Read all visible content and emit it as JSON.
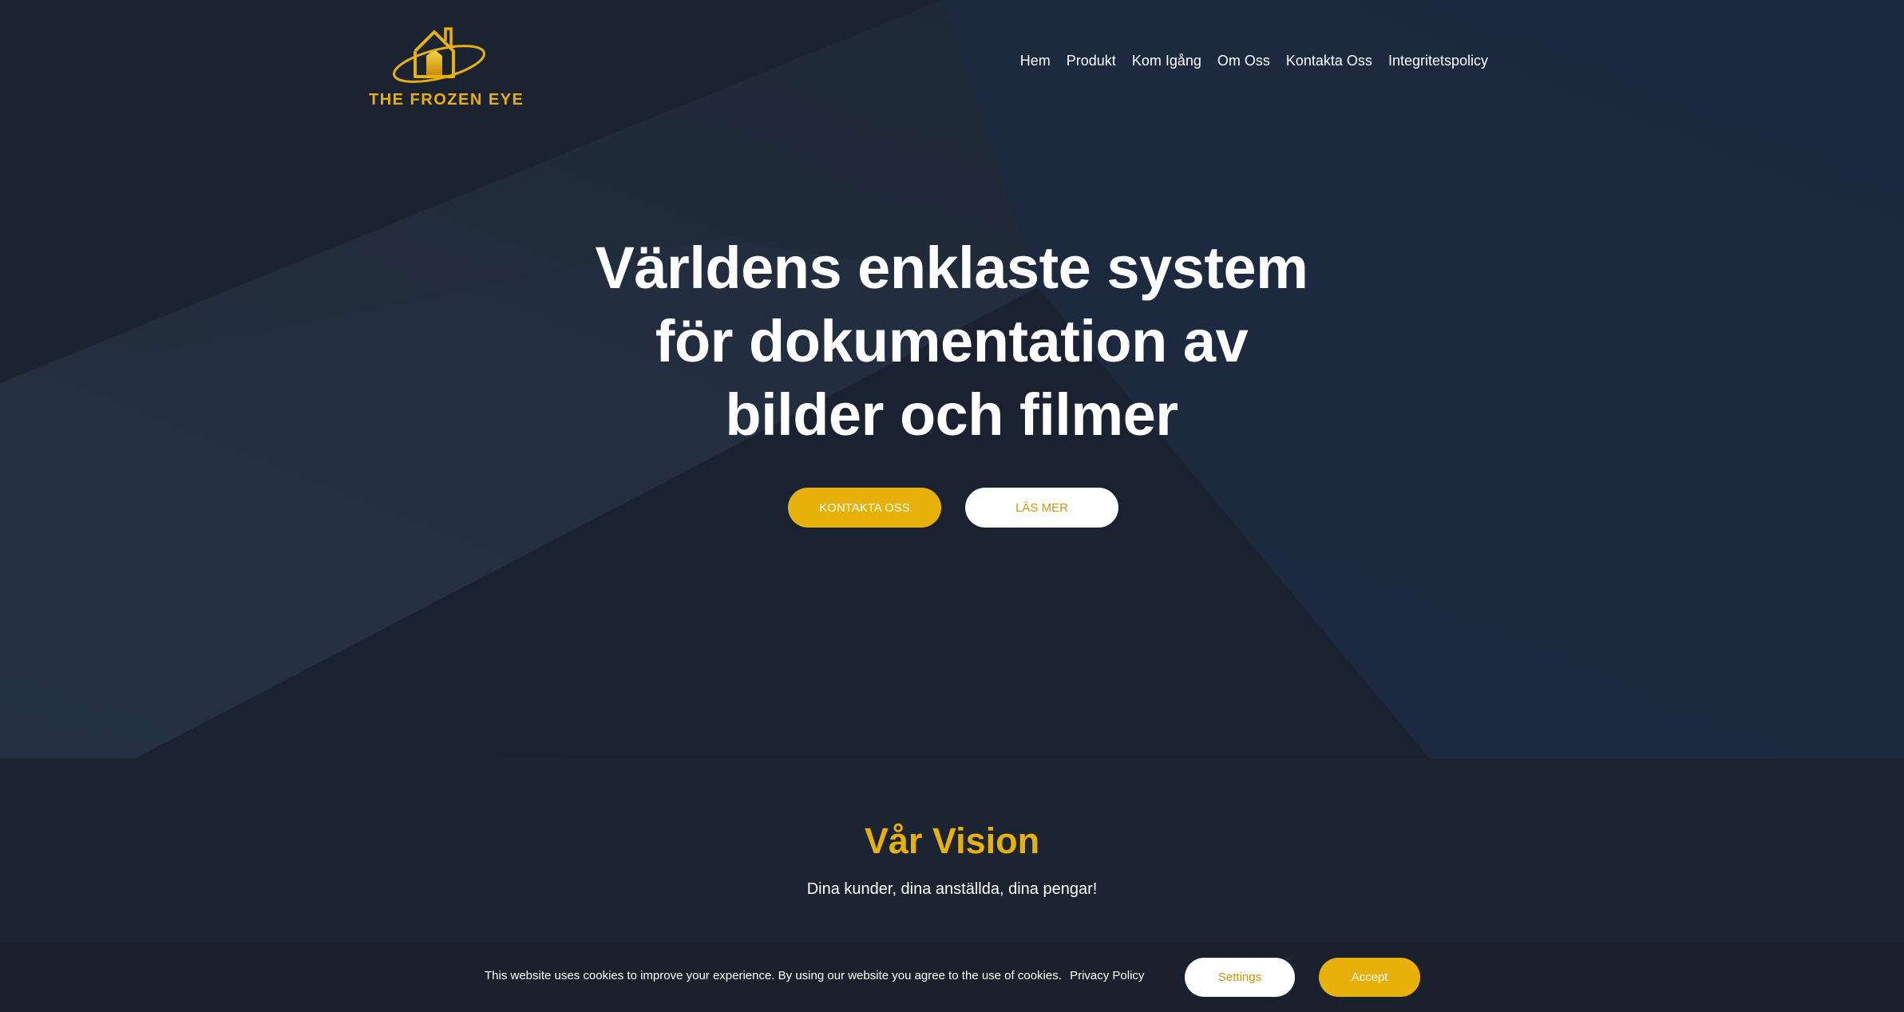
{
  "brand": {
    "name": "THE FROZEN EYE",
    "logo_icon": "house-orbit-icon",
    "accent_color": "#e8b10a"
  },
  "nav": {
    "items": [
      {
        "label": "Hem"
      },
      {
        "label": "Produkt"
      },
      {
        "label": "Kom Igång"
      },
      {
        "label": "Om Oss"
      },
      {
        "label": "Kontakta Oss"
      },
      {
        "label": "Integritetspolicy"
      }
    ]
  },
  "hero": {
    "title_line1": "Världens enklaste system",
    "title_line2": "för dokumentation av",
    "title_line3": "bilder och filmer",
    "primary_button": "KONTAKTA OSS",
    "secondary_button": "LÄS MER",
    "background_color": "#1b2230"
  },
  "vision": {
    "title": "Vår Vision",
    "subtitle": "Dina kunder, dina anställda, dina pengar!"
  },
  "cookie": {
    "text": "This website uses cookies to improve your experience. By using our website you agree to the use of cookies.",
    "policy_link": "Privacy Policy",
    "settings_button": "Settings",
    "accept_button": "Accept"
  }
}
